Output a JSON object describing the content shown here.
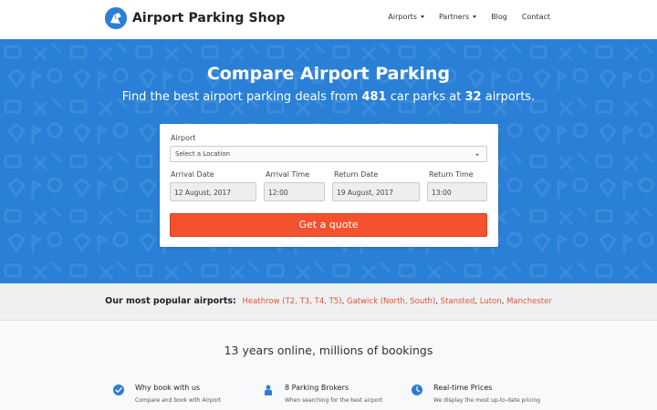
{
  "header": {
    "brand": "Airport Parking Shop",
    "nav": [
      {
        "label": "Airports",
        "dropdown": true
      },
      {
        "label": "Partners",
        "dropdown": true
      },
      {
        "label": "Blog",
        "dropdown": false
      },
      {
        "label": "Contact",
        "dropdown": false
      }
    ]
  },
  "hero": {
    "title": "Compare Airport Parking",
    "subtitle_pre": "Find the best airport parking deals from ",
    "car_parks": "481",
    "subtitle_mid": " car parks at ",
    "airports": "32",
    "subtitle_post": " airports."
  },
  "form": {
    "airport_label": "Airport",
    "airport_value": "Select a Location",
    "arrival_date_label": "Arrival Date",
    "arrival_date_value": "12 August, 2017",
    "arrival_time_label": "Arrival Time",
    "arrival_time_value": "12:00",
    "return_date_label": "Return Date",
    "return_date_value": "19 August, 2017",
    "return_time_label": "Return Time",
    "return_time_value": "13:00",
    "submit_label": "Get a quote"
  },
  "popular": {
    "label": "Our most popular airports:",
    "heathrow": "Heathrow",
    "heathrow_terms": [
      "T2",
      "T3",
      "T4",
      "T5"
    ],
    "gatwick": "Gatwick",
    "gatwick_terms": [
      "North",
      "South"
    ],
    "others": [
      "Stansted",
      "Luton",
      "Manchester"
    ]
  },
  "info": {
    "headline": "13 years online, millions of bookings",
    "features": [
      {
        "icon": "check-circle-icon",
        "title": "Why book with us",
        "text": "Compare and book with Airport"
      },
      {
        "icon": "person-icon",
        "title": "8 Parking Brokers",
        "text": "When searching for the best airport"
      },
      {
        "icon": "clock-icon",
        "title": "Real-time Prices",
        "text": "We display the most up-to-date pricing"
      }
    ]
  },
  "colors": {
    "brand_blue": "#2a7fd6",
    "accent_red": "#f4522e",
    "link_red": "#e8543a"
  }
}
